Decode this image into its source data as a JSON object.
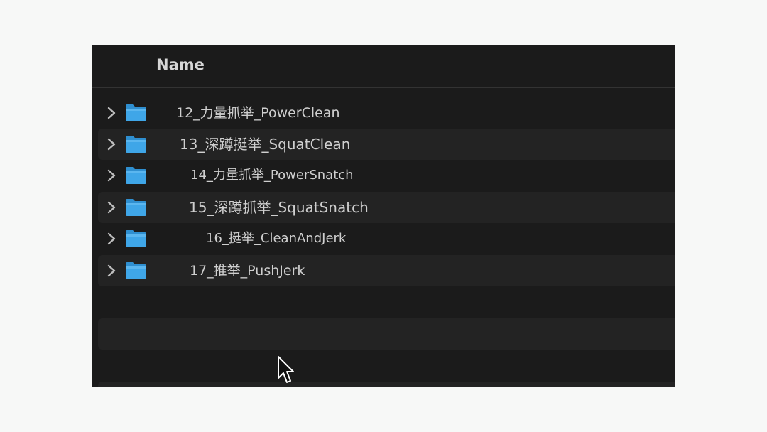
{
  "header": {
    "name_column": "Name"
  },
  "rows": [
    {
      "label": "12_力量抓举_PowerClean"
    },
    {
      "label": "13_深蹲挺举_SquatClean"
    },
    {
      "label": "14_力量抓举_PowerSnatch"
    },
    {
      "label": "15_深蹲抓举_SquatSnatch"
    },
    {
      "label": "16_挺举_CleanAndJerk"
    },
    {
      "label": "17_推举_PushJerk"
    }
  ],
  "icons": {
    "row_disclosure": "chevron-right-icon",
    "row_item": "folder-icon",
    "pointer": "mouse-cursor-icon"
  },
  "colors": {
    "background": "#1b1b1b",
    "row_stripe": "#232323",
    "text": "#cfcfcf",
    "folder": "#3fa6e8"
  }
}
